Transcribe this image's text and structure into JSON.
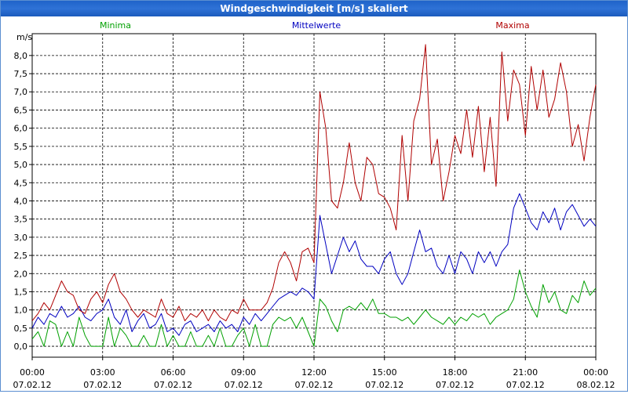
{
  "window": {
    "title": "Windgeschwindigkeit [m/s] skaliert"
  },
  "chart_data": {
    "type": "line",
    "title": "Windgeschwindigkeit [m/s] skaliert",
    "ylabel": "m/s",
    "ylim": [
      -0.3,
      8.6
    ],
    "xlim": [
      0,
      24
    ],
    "grid": true,
    "legend_placement": "top",
    "y_ticks": [
      "0,0",
      "0,5",
      "1,0",
      "1,5",
      "2,0",
      "2,5",
      "3,0",
      "3,5",
      "4,0",
      "4,5",
      "5,0",
      "5,5",
      "6,0",
      "6,5",
      "7,0",
      "7,5",
      "8,0"
    ],
    "x_ticks": [
      {
        "time": "00:00",
        "date": "07.02.12"
      },
      {
        "time": "03:00",
        "date": "07.02.12"
      },
      {
        "time": "06:00",
        "date": "07.02.12"
      },
      {
        "time": "09:00",
        "date": "07.02.12"
      },
      {
        "time": "12:00",
        "date": "07.02.12"
      },
      {
        "time": "15:00",
        "date": "07.02.12"
      },
      {
        "time": "18:00",
        "date": "07.02.12"
      },
      {
        "time": "21:00",
        "date": "07.02.12"
      },
      {
        "time": "00:00",
        "date": "08.02.12"
      }
    ],
    "series": [
      {
        "name": "Minima",
        "color": "#00a000",
        "points": [
          [
            0,
            0.2
          ],
          [
            0.25,
            0.4
          ],
          [
            0.5,
            0
          ],
          [
            0.75,
            0.7
          ],
          [
            1,
            0.6
          ],
          [
            1.25,
            0
          ],
          [
            1.5,
            0.4
          ],
          [
            1.75,
            0
          ],
          [
            2,
            0.8
          ],
          [
            2.25,
            0.3
          ],
          [
            2.5,
            0
          ],
          [
            2.75,
            0
          ],
          [
            3,
            0
          ],
          [
            3.25,
            0.8
          ],
          [
            3.5,
            0
          ],
          [
            3.75,
            0.5
          ],
          [
            4,
            0.3
          ],
          [
            4.25,
            0
          ],
          [
            4.5,
            0
          ],
          [
            4.75,
            0.3
          ],
          [
            5,
            0
          ],
          [
            5.25,
            0
          ],
          [
            5.5,
            0.6
          ],
          [
            5.75,
            0
          ],
          [
            6,
            0.3
          ],
          [
            6.25,
            0
          ],
          [
            6.5,
            0
          ],
          [
            6.75,
            0.4
          ],
          [
            7,
            0
          ],
          [
            7.25,
            0
          ],
          [
            7.5,
            0.3
          ],
          [
            7.75,
            0
          ],
          [
            8,
            0.5
          ],
          [
            8.25,
            0
          ],
          [
            8.5,
            0
          ],
          [
            8.75,
            0.3
          ],
          [
            9,
            0.5
          ],
          [
            9.25,
            0
          ],
          [
            9.5,
            0.6
          ],
          [
            9.75,
            0
          ],
          [
            10,
            0
          ],
          [
            10.25,
            0.6
          ],
          [
            10.5,
            0.8
          ],
          [
            10.75,
            0.7
          ],
          [
            11,
            0.8
          ],
          [
            11.25,
            0.5
          ],
          [
            11.5,
            0.8
          ],
          [
            11.75,
            0.4
          ],
          [
            12,
            0
          ],
          [
            12.25,
            1.3
          ],
          [
            12.5,
            1.1
          ],
          [
            12.75,
            0.7
          ],
          [
            13,
            0.4
          ],
          [
            13.25,
            1.0
          ],
          [
            13.5,
            1.1
          ],
          [
            13.75,
            1.0
          ],
          [
            14,
            1.2
          ],
          [
            14.25,
            1.0
          ],
          [
            14.5,
            1.3
          ],
          [
            14.75,
            0.9
          ],
          [
            15,
            0.9
          ],
          [
            15.25,
            0.8
          ],
          [
            15.5,
            0.8
          ],
          [
            15.75,
            0.7
          ],
          [
            16,
            0.8
          ],
          [
            16.25,
            0.6
          ],
          [
            16.5,
            0.8
          ],
          [
            16.75,
            1.0
          ],
          [
            17,
            0.8
          ],
          [
            17.25,
            0.7
          ],
          [
            17.5,
            0.6
          ],
          [
            17.75,
            0.8
          ],
          [
            18,
            0.6
          ],
          [
            18.25,
            0.8
          ],
          [
            18.5,
            0.7
          ],
          [
            18.75,
            0.9
          ],
          [
            19,
            0.8
          ],
          [
            19.25,
            0.9
          ],
          [
            19.5,
            0.6
          ],
          [
            19.75,
            0.8
          ],
          [
            20,
            0.9
          ],
          [
            20.25,
            1.0
          ],
          [
            20.5,
            1.3
          ],
          [
            20.75,
            2.1
          ],
          [
            21,
            1.5
          ],
          [
            21.25,
            1.1
          ],
          [
            21.5,
            0.8
          ],
          [
            21.75,
            1.7
          ],
          [
            22,
            1.2
          ],
          [
            22.25,
            1.5
          ],
          [
            22.5,
            1.0
          ],
          [
            22.75,
            0.9
          ],
          [
            23,
            1.4
          ],
          [
            23.25,
            1.2
          ],
          [
            23.5,
            1.8
          ],
          [
            23.75,
            1.4
          ],
          [
            24,
            1.6
          ]
        ]
      },
      {
        "name": "Mittelwerte",
        "color": "#0000c0",
        "points": [
          [
            0,
            0.5
          ],
          [
            0.25,
            0.8
          ],
          [
            0.5,
            0.6
          ],
          [
            0.75,
            0.9
          ],
          [
            1,
            0.8
          ],
          [
            1.25,
            1.1
          ],
          [
            1.5,
            0.8
          ],
          [
            1.75,
            0.9
          ],
          [
            2,
            1.1
          ],
          [
            2.25,
            0.8
          ],
          [
            2.5,
            0.7
          ],
          [
            2.75,
            0.9
          ],
          [
            3,
            1.0
          ],
          [
            3.25,
            1.3
          ],
          [
            3.5,
            0.8
          ],
          [
            3.75,
            0.6
          ],
          [
            4,
            1.0
          ],
          [
            4.25,
            0.4
          ],
          [
            4.5,
            0.7
          ],
          [
            4.75,
            0.9
          ],
          [
            5,
            0.5
          ],
          [
            5.25,
            0.6
          ],
          [
            5.5,
            0.9
          ],
          [
            5.75,
            0.4
          ],
          [
            6,
            0.5
          ],
          [
            6.25,
            0.3
          ],
          [
            6.5,
            0.6
          ],
          [
            6.75,
            0.7
          ],
          [
            7,
            0.4
          ],
          [
            7.25,
            0.5
          ],
          [
            7.5,
            0.6
          ],
          [
            7.75,
            0.4
          ],
          [
            8,
            0.7
          ],
          [
            8.25,
            0.5
          ],
          [
            8.5,
            0.6
          ],
          [
            8.75,
            0.4
          ],
          [
            9,
            0.8
          ],
          [
            9.25,
            0.6
          ],
          [
            9.5,
            0.9
          ],
          [
            9.75,
            0.7
          ],
          [
            10,
            0.9
          ],
          [
            10.25,
            1.1
          ],
          [
            10.5,
            1.3
          ],
          [
            10.75,
            1.4
          ],
          [
            11,
            1.5
          ],
          [
            11.25,
            1.4
          ],
          [
            11.5,
            1.6
          ],
          [
            11.75,
            1.5
          ],
          [
            12,
            1.3
          ],
          [
            12.25,
            3.6
          ],
          [
            12.5,
            2.8
          ],
          [
            12.75,
            2.0
          ],
          [
            13,
            2.5
          ],
          [
            13.25,
            3.0
          ],
          [
            13.5,
            2.6
          ],
          [
            13.75,
            2.9
          ],
          [
            14,
            2.4
          ],
          [
            14.25,
            2.2
          ],
          [
            14.5,
            2.2
          ],
          [
            14.75,
            2.0
          ],
          [
            15,
            2.4
          ],
          [
            15.25,
            2.6
          ],
          [
            15.5,
            2.0
          ],
          [
            15.75,
            1.7
          ],
          [
            16,
            2.0
          ],
          [
            16.25,
            2.6
          ],
          [
            16.5,
            3.2
          ],
          [
            16.75,
            2.6
          ],
          [
            17,
            2.7
          ],
          [
            17.25,
            2.2
          ],
          [
            17.5,
            2.0
          ],
          [
            17.75,
            2.5
          ],
          [
            18,
            2.0
          ],
          [
            18.25,
            2.6
          ],
          [
            18.5,
            2.4
          ],
          [
            18.75,
            2.0
          ],
          [
            19,
            2.6
          ],
          [
            19.25,
            2.3
          ],
          [
            19.5,
            2.6
          ],
          [
            19.75,
            2.2
          ],
          [
            20,
            2.6
          ],
          [
            20.25,
            2.8
          ],
          [
            20.5,
            3.8
          ],
          [
            20.75,
            4.2
          ],
          [
            21,
            3.8
          ],
          [
            21.25,
            3.4
          ],
          [
            21.5,
            3.2
          ],
          [
            21.75,
            3.7
          ],
          [
            22,
            3.4
          ],
          [
            22.25,
            3.8
          ],
          [
            22.5,
            3.2
          ],
          [
            22.75,
            3.7
          ],
          [
            23,
            3.9
          ],
          [
            23.25,
            3.6
          ],
          [
            23.5,
            3.3
          ],
          [
            23.75,
            3.5
          ],
          [
            24,
            3.3
          ]
        ]
      },
      {
        "name": "Maxima",
        "color": "#b00000",
        "points": [
          [
            0,
            0.7
          ],
          [
            0.25,
            0.9
          ],
          [
            0.5,
            1.2
          ],
          [
            0.75,
            1.0
          ],
          [
            1,
            1.4
          ],
          [
            1.25,
            1.8
          ],
          [
            1.5,
            1.5
          ],
          [
            1.75,
            1.4
          ],
          [
            2,
            1.0
          ],
          [
            2.25,
            0.9
          ],
          [
            2.5,
            1.3
          ],
          [
            2.75,
            1.5
          ],
          [
            3,
            1.2
          ],
          [
            3.25,
            1.7
          ],
          [
            3.5,
            2.0
          ],
          [
            3.75,
            1.5
          ],
          [
            4,
            1.3
          ],
          [
            4.25,
            1.0
          ],
          [
            4.5,
            0.8
          ],
          [
            4.75,
            1.0
          ],
          [
            5,
            0.9
          ],
          [
            5.25,
            0.8
          ],
          [
            5.5,
            1.3
          ],
          [
            5.75,
            0.9
          ],
          [
            6,
            0.8
          ],
          [
            6.25,
            1.1
          ],
          [
            6.5,
            0.7
          ],
          [
            6.75,
            0.9
          ],
          [
            7,
            0.8
          ],
          [
            7.25,
            1.0
          ],
          [
            7.5,
            0.7
          ],
          [
            7.75,
            1.0
          ],
          [
            8,
            0.8
          ],
          [
            8.25,
            0.7
          ],
          [
            8.5,
            1.0
          ],
          [
            8.75,
            0.9
          ],
          [
            9,
            1.3
          ],
          [
            9.25,
            1.0
          ],
          [
            9.5,
            1.0
          ],
          [
            9.75,
            1.0
          ],
          [
            10,
            1.2
          ],
          [
            10.25,
            1.6
          ],
          [
            10.5,
            2.3
          ],
          [
            10.75,
            2.6
          ],
          [
            11,
            2.3
          ],
          [
            11.25,
            1.8
          ],
          [
            11.5,
            2.6
          ],
          [
            11.75,
            2.7
          ],
          [
            12,
            2.3
          ],
          [
            12.25,
            7.0
          ],
          [
            12.5,
            6.0
          ],
          [
            12.75,
            4.0
          ],
          [
            13,
            3.8
          ],
          [
            13.25,
            4.5
          ],
          [
            13.5,
            5.6
          ],
          [
            13.75,
            4.5
          ],
          [
            14,
            4.0
          ],
          [
            14.25,
            5.2
          ],
          [
            14.5,
            5.0
          ],
          [
            14.75,
            4.2
          ],
          [
            15,
            4.1
          ],
          [
            15.25,
            3.8
          ],
          [
            15.5,
            3.2
          ],
          [
            15.75,
            5.8
          ],
          [
            16,
            4.0
          ],
          [
            16.25,
            6.2
          ],
          [
            16.5,
            6.8
          ],
          [
            16.75,
            8.3
          ],
          [
            17,
            5.0
          ],
          [
            17.25,
            5.7
          ],
          [
            17.5,
            4.0
          ],
          [
            17.75,
            4.8
          ],
          [
            18,
            5.8
          ],
          [
            18.25,
            5.3
          ],
          [
            18.5,
            6.5
          ],
          [
            18.75,
            5.2
          ],
          [
            19,
            6.6
          ],
          [
            19.25,
            4.8
          ],
          [
            19.5,
            6.3
          ],
          [
            19.75,
            4.4
          ],
          [
            20,
            8.1
          ],
          [
            20.25,
            6.2
          ],
          [
            20.5,
            7.6
          ],
          [
            20.75,
            7.2
          ],
          [
            21,
            5.8
          ],
          [
            21.25,
            7.7
          ],
          [
            21.5,
            6.5
          ],
          [
            21.75,
            7.6
          ],
          [
            22,
            6.3
          ],
          [
            22.25,
            6.8
          ],
          [
            22.5,
            7.8
          ],
          [
            22.75,
            7.0
          ],
          [
            23,
            5.5
          ],
          [
            23.25,
            6.1
          ],
          [
            23.5,
            5.1
          ],
          [
            23.75,
            6.3
          ],
          [
            24,
            7.2
          ]
        ]
      }
    ]
  }
}
